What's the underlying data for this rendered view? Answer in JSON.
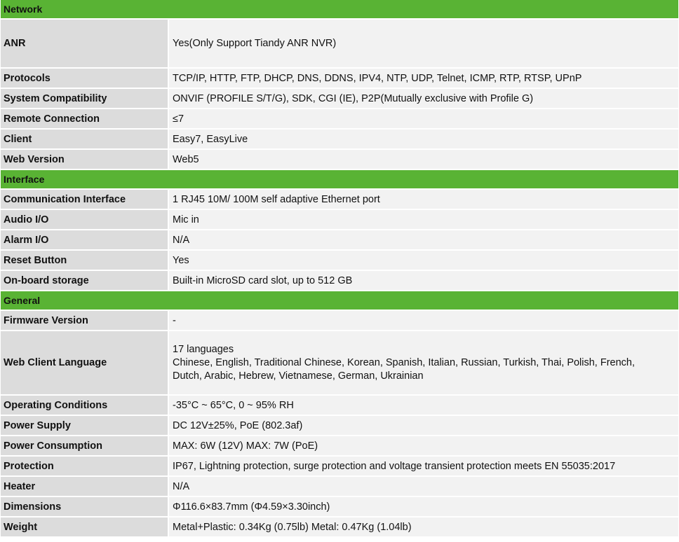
{
  "sections": {
    "network": "Network",
    "interface": "Interface",
    "general": "General"
  },
  "rows": {
    "anr": {
      "label": "ANR",
      "value": "Yes(Only Support Tiandy ANR NVR)"
    },
    "protocols": {
      "label": "Protocols",
      "value": "TCP/IP, HTTP, FTP, DHCP, DNS, DDNS, IPV4, NTP, UDP, Telnet, ICMP, RTP, RTSP, UPnP"
    },
    "system_compatibility": {
      "label": "System Compatibility",
      "value": "ONVIF (PROFILE S/T/G), SDK, CGI (IE), P2P(Mutually exclusive with Profile G)"
    },
    "remote_connection": {
      "label": "Remote Connection",
      "value": "≤7"
    },
    "client": {
      "label": "Client",
      "value": "Easy7, EasyLive"
    },
    "web_version": {
      "label": "Web Version",
      "value": "Web5"
    },
    "communication_interface": {
      "label": "Communication Interface",
      "value": "1 RJ45 10M/ 100M self adaptive Ethernet port"
    },
    "audio_io": {
      "label": "Audio I/O",
      "value": "Mic in"
    },
    "alarm_io": {
      "label": "Alarm I/O",
      "value": "N/A"
    },
    "reset_button": {
      "label": "Reset Button",
      "value": "Yes"
    },
    "onboard_storage": {
      "label": "On-board storage",
      "value": "Built-in MicroSD card slot, up to 512 GB"
    },
    "firmware_version": {
      "label": "Firmware Version",
      "value": "-"
    },
    "web_client_language": {
      "label": "Web Client Language",
      "line1": "17 languages",
      "line2": "Chinese, English, Traditional Chinese, Korean, Spanish, Italian, Russian, Turkish, Thai, Polish, French,",
      "line3": "Dutch, Arabic, Hebrew, Vietnamese, German, Ukrainian"
    },
    "operating_conditions": {
      "label": "Operating Conditions",
      "value": "-35°C ~ 65°C, 0 ~ 95% RH"
    },
    "power_supply": {
      "label": "Power Supply",
      "value": "DC 12V±25%, PoE (802.3af)"
    },
    "power_consumption": {
      "label": "Power Consumption",
      "value": "MAX: 6W (12V) MAX: 7W (PoE)"
    },
    "protection": {
      "label": "Protection",
      "value": "IP67, Lightning protection, surge protection and voltage transient protection meets EN 55035:2017"
    },
    "heater": {
      "label": "Heater",
      "value": "N/A"
    },
    "dimensions": {
      "label": "Dimensions",
      "value": "Φ116.6×83.7mm (Φ4.59×3.30inch)"
    },
    "weight": {
      "label": "Weight",
      "value": "Metal+Plastic: 0.34Kg (0.75lb) Metal: 0.47Kg (1.04lb)"
    }
  },
  "colors": {
    "section_header": "#59b334",
    "label_bg": "#dcdcdc",
    "value_bg": "#f2f2f2"
  }
}
